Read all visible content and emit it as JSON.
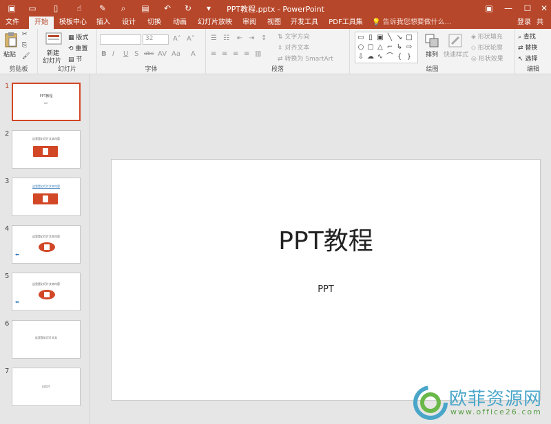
{
  "titlebar": {
    "title": "PPT教程.pptx - PowerPoint",
    "qa_icons": [
      "save-icon",
      "open-icon",
      "new-icon",
      "touch-mode-icon",
      "format-painter-icon",
      "print-preview-icon",
      "slideshow-icon",
      "undo-icon",
      "redo-icon",
      "customize-icon"
    ],
    "window_icons": [
      "ribbon-display-icon",
      "minimize-icon",
      "maximize-icon",
      "close-icon"
    ]
  },
  "tabs": {
    "items": [
      "文件",
      "开始",
      "模板中心",
      "插入",
      "设计",
      "切换",
      "动画",
      "幻灯片放映",
      "审阅",
      "视图",
      "开发工具",
      "PDF工具集"
    ],
    "active": "开始",
    "tell_me": "告诉我您想要做什么...",
    "login": "登录",
    "share": "共"
  },
  "ribbon": {
    "clipboard": {
      "paste": "粘贴",
      "label": "剪贴板"
    },
    "slides": {
      "new_slide": "新建",
      "new_slide2": "幻灯片",
      "layout": "版式",
      "reset": "重置",
      "section": "节",
      "label": "幻灯片"
    },
    "font": {
      "font_size": "32",
      "bold": "B",
      "italic": "I",
      "underline": "U",
      "strike": "S",
      "shadow": "abc",
      "spacing": "AV",
      "case": "Aa",
      "color": "A",
      "label": "字体"
    },
    "paragraph": {
      "text_direction": "文字方向",
      "align_text": "对齐文本",
      "smartart": "转换为 SmartArt",
      "label": "段落"
    },
    "drawing": {
      "arrange": "排列",
      "quick_styles": "快速样式",
      "fill": "形状填充",
      "outline": "形状轮廓",
      "effects": "形状效果",
      "label": "绘图"
    },
    "editing": {
      "find": "查找",
      "replace": "替换",
      "select": "选择",
      "label": "编辑"
    }
  },
  "slides": [
    {
      "num": "1",
      "title": "PPT教程",
      "sub": "PPT"
    },
    {
      "num": "2",
      "title": "这里是幻灯片文本内容"
    },
    {
      "num": "3",
      "title": "这里是幻灯片文本内容"
    },
    {
      "num": "4",
      "title": "这里是幻灯片文本内容"
    },
    {
      "num": "5",
      "title": "这里是幻灯片文本内容"
    },
    {
      "num": "6",
      "title": "这里是幻灯片文本"
    },
    {
      "num": "7",
      "title": "幻灯片"
    }
  ],
  "current_slide": {
    "title": "PPT教程",
    "subtitle": "PPT"
  },
  "watermark": {
    "text": "欧菲资源网",
    "url": "www.office26.com"
  }
}
